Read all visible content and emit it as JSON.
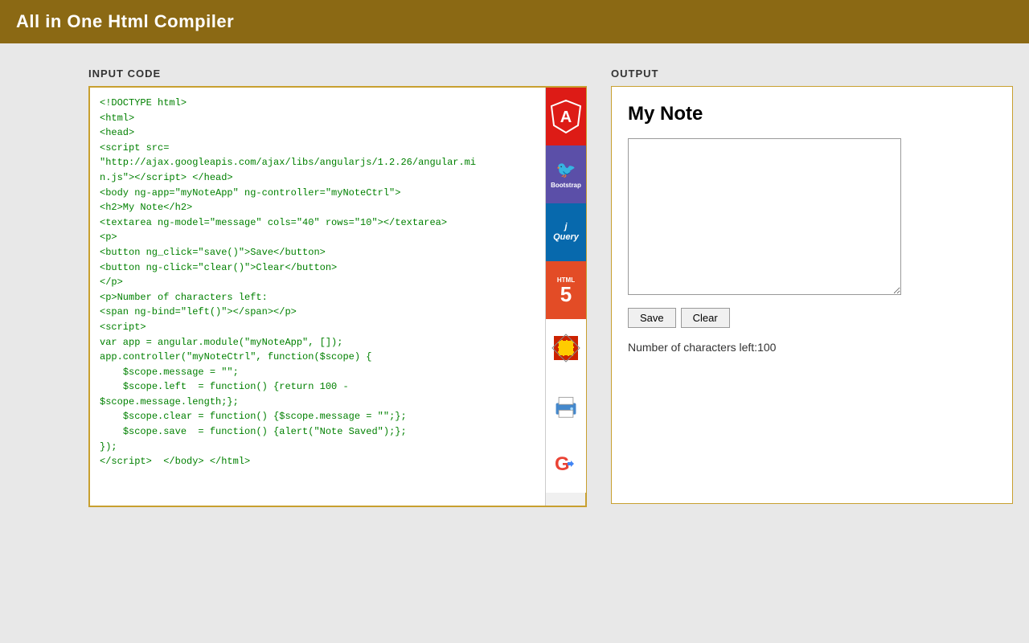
{
  "header": {
    "title": "All in One Html Compiler"
  },
  "left": {
    "label": "INPUT CODE",
    "code": "<!DOCTYPE html>\n<html>\n<head>\n<script src=\n\"http://ajax.googleapis.com/ajax/libs/angularjs/1.2.26/angular.mi\nn.js\"></script> </head>\n<body ng-app=\"myNoteApp\" ng-controller=\"myNoteCtrl\">\n<h2>My Note</h2>\n<textarea ng-model=\"message\" cols=\"40\" rows=\"10\"></textarea>\n<p>\n<button ng_click=\"save()\">Save</button>\n<button ng-click=\"clear()\">Clear</button>\n</p>\n<p>Number of characters left:\n<span ng-bind=\"left()\"></span></p>\n<script>\nvar app = angular.module(\"myNoteApp\", []);\napp.controller(\"myNoteCtrl\", function($scope) {\n    $scope.message = \"\";\n    $scope.left  = function() {return 100 -\n$scope.message.length;};\n    $scope.clear = function() {$scope.message = \"\";};\n    $scope.save  = function() {alert(\"Note Saved\");};\n});\n</script>  </body> </html>"
  },
  "icons": [
    {
      "name": "angular-icon",
      "type": "angular",
      "label": "Angular"
    },
    {
      "name": "bootstrap-icon",
      "type": "bootstrap",
      "label": "Bootstrap"
    },
    {
      "name": "jquery-icon",
      "type": "jquery",
      "label": "jQuery"
    },
    {
      "name": "html5-icon",
      "type": "html5",
      "label": "HTML5"
    },
    {
      "name": "tool-icon",
      "type": "tool",
      "label": "Tool"
    },
    {
      "name": "print-icon",
      "type": "print",
      "label": "Print"
    },
    {
      "name": "google-icon",
      "type": "google",
      "label": "Google"
    }
  ],
  "right": {
    "label": "OUTPUT",
    "output_title": "My Note",
    "textarea_placeholder": "",
    "save_button": "Save",
    "clear_button": "Clear",
    "chars_label": "Number of characters left:",
    "chars_value": "100"
  }
}
